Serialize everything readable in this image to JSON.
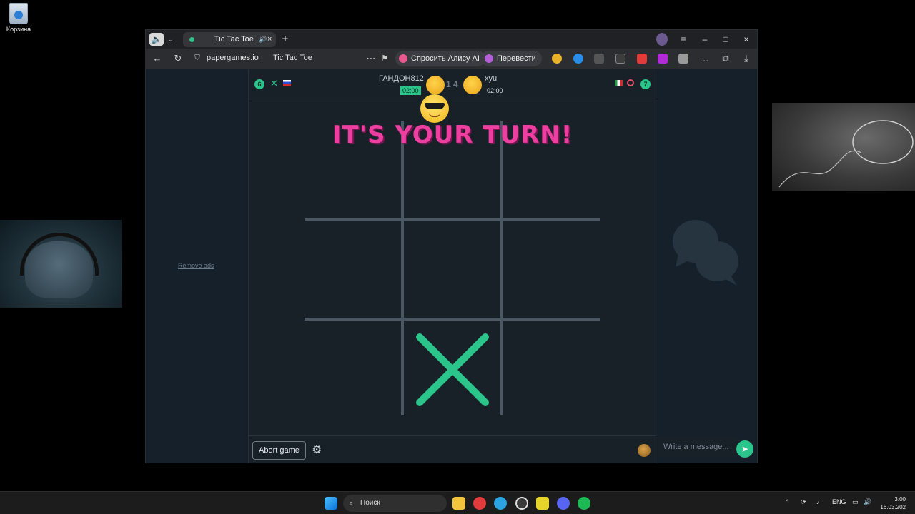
{
  "desktop": {
    "recycle_bin_label": "Корзина"
  },
  "browser": {
    "tab_title": "Tic Tac Toe",
    "url": "papergames.io",
    "page_title": "Tic Tac Toe",
    "alice_label": "Спросить Алису AI",
    "translate_label": "Перевести"
  },
  "game": {
    "player1": {
      "name": "ГАНДОН812",
      "time": "02:00",
      "badge": "6"
    },
    "player2": {
      "name": "xyu",
      "time": "02:00",
      "badge": "7"
    },
    "score": "1 4",
    "turn_message": "IT'S YOUR TURN!",
    "abort_label": "Abort game",
    "remove_ads_label": "Remove ads",
    "message_placeholder": "Write a message..."
  },
  "taskbar": {
    "search_label": "Поиск",
    "lang": "ENG",
    "time": "3:00",
    "date": "16.03.202"
  },
  "colors": {
    "accent": "#2bc48a",
    "turn_text": "#ec3fa0",
    "board_lines": "#4b5864"
  }
}
